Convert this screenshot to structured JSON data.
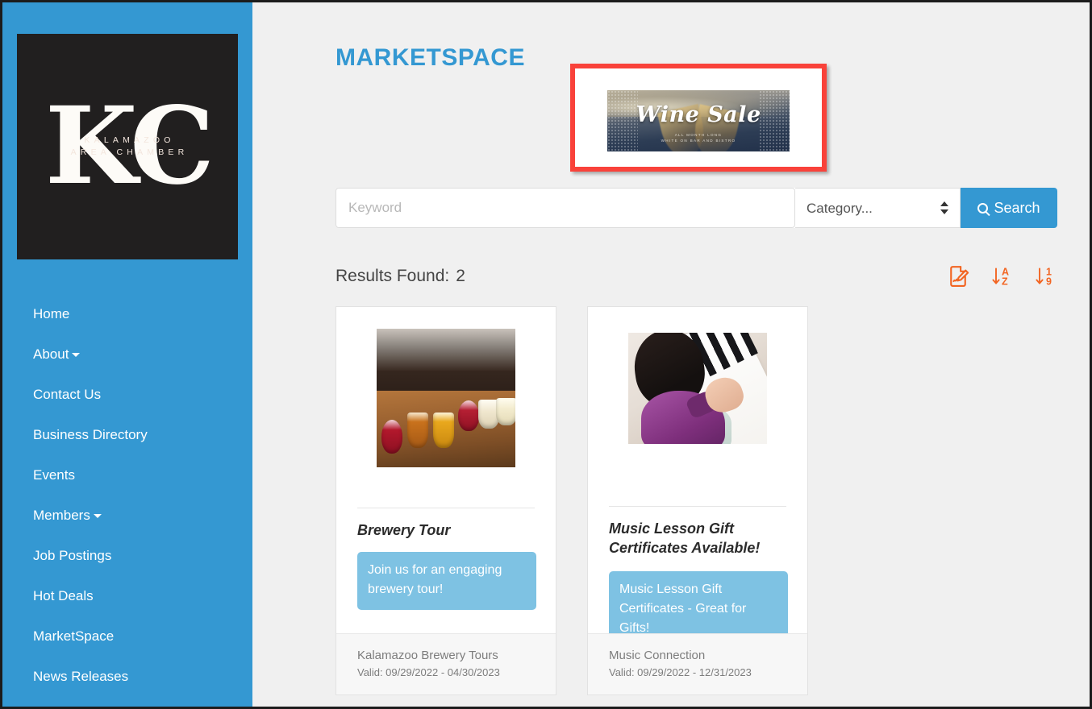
{
  "sidebar": {
    "logo": {
      "monogram": "KC",
      "line1": "KALAMAZOO",
      "line2": "AREA CHAMBER"
    },
    "items": [
      {
        "label": "Home",
        "has_caret": false
      },
      {
        "label": "About",
        "has_caret": true
      },
      {
        "label": "Contact Us",
        "has_caret": false
      },
      {
        "label": "Business Directory",
        "has_caret": false
      },
      {
        "label": "Events",
        "has_caret": false
      },
      {
        "label": "Members",
        "has_caret": true
      },
      {
        "label": "Job Postings",
        "has_caret": false
      },
      {
        "label": "Hot Deals",
        "has_caret": false
      },
      {
        "label": "MarketSpace",
        "has_caret": false
      },
      {
        "label": "News Releases",
        "has_caret": false
      }
    ]
  },
  "main": {
    "page_title": "MARKETSPACE",
    "ad": {
      "title": "Wine Sale",
      "subtitle_line1": "ALL MONTH LONG",
      "subtitle_line2": "WHITE ON BAR AND BISTRO"
    },
    "search": {
      "keyword_placeholder": "Keyword",
      "keyword_value": "",
      "category_selected": "Category...",
      "search_label": "Search"
    },
    "results": {
      "label": "Results Found:",
      "count": "2",
      "tools": [
        {
          "name": "file-signature-icon"
        },
        {
          "name": "sort-alpha-down-icon",
          "letters": [
            "A",
            "Z"
          ]
        },
        {
          "name": "sort-numeric-down-icon",
          "letters": [
            "1",
            "9"
          ]
        }
      ]
    },
    "cards": [
      {
        "title": "Brewery Tour",
        "badge": "Join us for an engaging brewery tour!",
        "company": "Kalamazoo Brewery Tours",
        "valid": "Valid: 09/29/2022 - 04/30/2023"
      },
      {
        "title": "Music Lesson Gift Certificates Available!",
        "badge": "Music Lesson Gift Certificates - Great for Gifts!",
        "company": "Music Connection",
        "valid": "Valid: 09/29/2022 - 12/31/2023"
      }
    ]
  },
  "colors": {
    "brand_blue": "#3498d2",
    "badge_blue": "#7ec2e3",
    "accent_orange": "#f26522",
    "highlight_red": "#f9423a",
    "page_background": "#f0f0f0",
    "logo_background": "#211f1f"
  }
}
